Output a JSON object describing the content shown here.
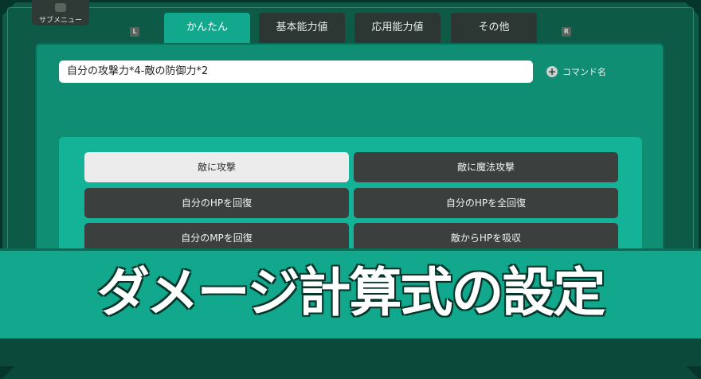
{
  "submenu": {
    "label": "サブメニュー",
    "icon": "submenu-icon"
  },
  "shoulders": {
    "left": "L",
    "right": "R"
  },
  "tabs": [
    {
      "label": "かんたん",
      "active": true
    },
    {
      "label": "基本能力値",
      "active": false
    },
    {
      "label": "応用能力値",
      "active": false
    },
    {
      "label": "その他",
      "active": false
    }
  ],
  "formula": {
    "value": "自分の攻撃力*4-敵の防御力*2"
  },
  "command": {
    "label": "コマンド名",
    "icon": "plus-icon"
  },
  "presets": [
    {
      "label": "敵に攻撃",
      "selected": true
    },
    {
      "label": "敵に魔法攻撃",
      "selected": false
    },
    {
      "label": "自分のHPを回復",
      "selected": false
    },
    {
      "label": "自分のHPを全回復",
      "selected": false
    },
    {
      "label": "自分のMPを回復",
      "selected": false
    },
    {
      "label": "敵からHPを吸収",
      "selected": false
    }
  ],
  "banner": {
    "title": "ダメージ計算式の設定"
  },
  "colors": {
    "background": "#0d5a46",
    "accent": "#12a88e",
    "button_dark": "#3b3f3e",
    "button_selected": "#ececec"
  }
}
